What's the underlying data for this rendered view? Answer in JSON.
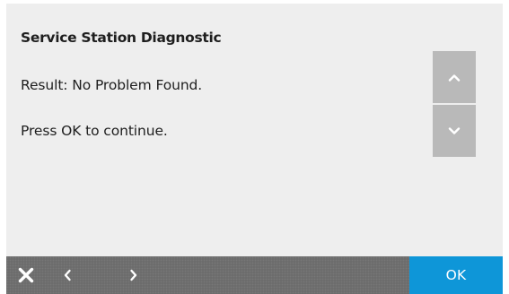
{
  "dialog": {
    "title": "Service Station Diagnostic",
    "result": "Result: No Problem Found.",
    "instruction": "Press OK to continue."
  },
  "scroll": {
    "up_icon": "chevron-up-icon",
    "down_icon": "chevron-down-icon"
  },
  "bottom_bar": {
    "close_icon": "close-icon",
    "back_icon": "chevron-left-icon",
    "forward_icon": "chevron-right-icon",
    "ok_label": "OK"
  },
  "colors": {
    "background": "#eeeeee",
    "scroll_button": "#b9b9b9",
    "nav_bar": "#6a6a6a",
    "ok_button": "#0e96d8",
    "text": "#1e1e1e"
  }
}
